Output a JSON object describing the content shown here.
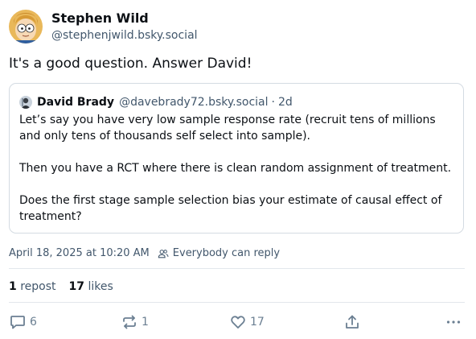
{
  "post": {
    "author": {
      "display_name": "Stephen Wild",
      "handle": "@stephenjwild.bsky.social"
    },
    "text": "It's a good question. Answer David!",
    "quote": {
      "author_name": "David Brady",
      "author_handle": "@davebrady72.bsky.social",
      "separator": "·",
      "time": "2d",
      "paragraphs": [
        "Let’s say you have very low sample response rate (recruit tens of millions and only tens of thousands self select into sample).",
        "Then you have a RCT where there is clean random assignment of treatment.",
        "Does the first stage sample selection bias your estimate of causal effect of treatment?"
      ]
    },
    "timestamp": "April 18, 2025 at 10:20 AM",
    "reply_setting": "Everybody can reply",
    "stats": {
      "reposts_count": "1",
      "reposts_label": "repost",
      "likes_count": "17",
      "likes_label": "likes"
    },
    "actions": {
      "reply_count": "6",
      "repost_count": "1",
      "like_count": "17"
    }
  },
  "icons": {
    "reply": "reply-icon",
    "repost": "repost-icon",
    "like": "heart-icon",
    "share": "share-icon",
    "more": "more-options-icon",
    "reply_setting": "people-icon"
  },
  "colors": {
    "text": "#0b0f14",
    "muted": "#42576c",
    "icon": "#6b7f92",
    "border": "#d4dbe2",
    "divider": "#e2e7ec"
  }
}
